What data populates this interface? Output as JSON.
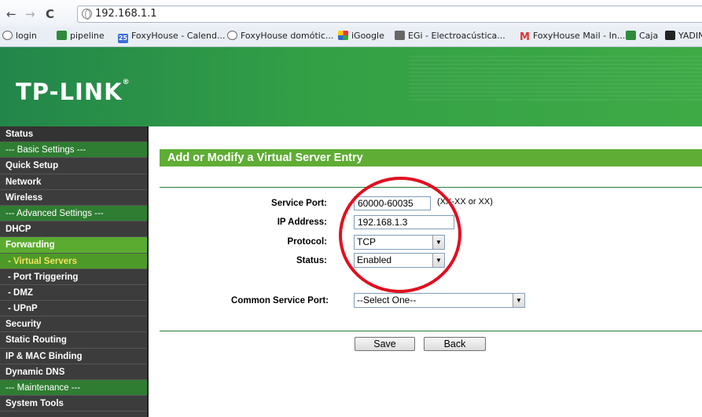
{
  "browser": {
    "url": "192.168.1.1",
    "bookmarks": [
      {
        "label": "login",
        "icon": "globe-icon"
      },
      {
        "label": "pipeline",
        "icon": "spreadsheet-icon"
      },
      {
        "label": "FoxyHouse - Calend...",
        "icon": "calendar-icon",
        "badge": "25"
      },
      {
        "label": "FoxyHouse domótic...",
        "icon": "globe-icon"
      },
      {
        "label": "iGoogle",
        "icon": "igoogle-icon"
      },
      {
        "label": "EGi - Electroacústica...",
        "icon": "egi-icon"
      },
      {
        "label": "FoxyHouse Mail - In...",
        "icon": "gmail-icon"
      },
      {
        "label": "Caja",
        "icon": "spreadsheet-icon"
      },
      {
        "label": "YADIN",
        "icon": "s-icon"
      }
    ]
  },
  "header": {
    "logo": "TP-LINK",
    "trademark": "®"
  },
  "sidebar": {
    "items": [
      {
        "label": "Status"
      },
      {
        "label": "--- Basic Settings ---"
      },
      {
        "label": "Quick Setup"
      },
      {
        "label": "Network"
      },
      {
        "label": "Wireless"
      },
      {
        "label": "--- Advanced Settings ---"
      },
      {
        "label": "DHCP"
      },
      {
        "label": "Forwarding"
      },
      {
        "label": "- Virtual Servers"
      },
      {
        "label": "- Port Triggering"
      },
      {
        "label": "- DMZ"
      },
      {
        "label": "- UPnP"
      },
      {
        "label": "Security"
      },
      {
        "label": "Static Routing"
      },
      {
        "label": "IP & MAC Binding"
      },
      {
        "label": "Dynamic DNS"
      },
      {
        "label": "--- Maintenance ---"
      },
      {
        "label": "System Tools"
      }
    ]
  },
  "form": {
    "title": "Add or Modify a Virtual Server Entry",
    "service_port": {
      "label": "Service Port:",
      "value": "60000-60035",
      "hint": "(XX-XX or XX)"
    },
    "ip_address": {
      "label": "IP Address:",
      "value": "192.168.1.3"
    },
    "protocol": {
      "label": "Protocol:",
      "value": "TCP"
    },
    "status": {
      "label": "Status:",
      "value": "Enabled"
    },
    "common_service_port": {
      "label": "Common Service Port:",
      "value": "--Select One--"
    },
    "save_label": "Save",
    "back_label": "Back"
  },
  "colors": {
    "brand_green": "#3eaa46",
    "title_green": "#5fad35",
    "sidebar_dark": "#3c3c3c",
    "highlight_ring": "#e01020",
    "active_submenu_text": "#f2e25c"
  }
}
